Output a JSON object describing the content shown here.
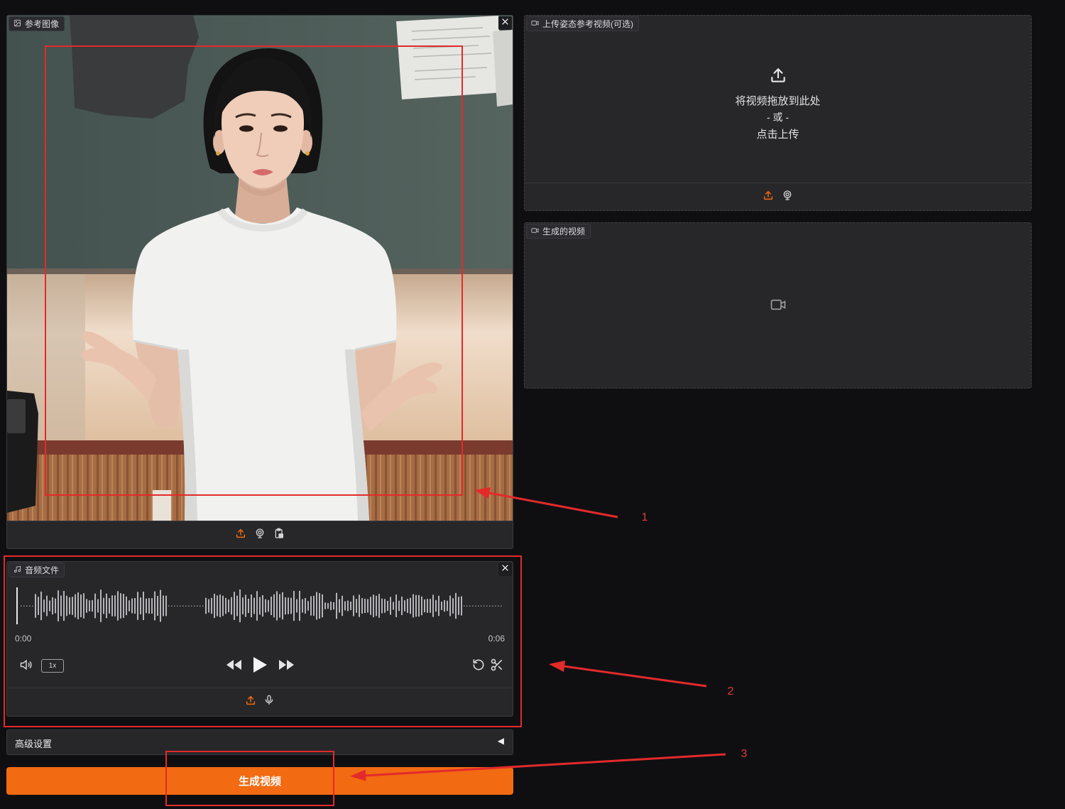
{
  "theme": {
    "background": "#0f0f12",
    "panel": "#27272a",
    "accent": "#f26a12",
    "annotation": "#e32a2a"
  },
  "reference_image": {
    "label": "参考图像",
    "icon": "image-icon",
    "toolbar_icons": [
      "upload-icon",
      "webcam-icon",
      "clipboard-icon"
    ]
  },
  "pose_video": {
    "label": "上传姿态参考视频(可选)",
    "icon": "video-icon",
    "drop_text": "将视频拖放到此处",
    "or_text": "- 或 -",
    "click_text": "点击上传",
    "toolbar_icons": [
      "upload-icon",
      "webcam-icon"
    ]
  },
  "output_video": {
    "label": "生成的视频",
    "icon": "video-icon",
    "placeholder_icon": "video-camera-icon"
  },
  "audio": {
    "label": "音频文件",
    "icon": "music-icon",
    "time_start": "0:00",
    "time_end": "0:06",
    "speed": "1x",
    "controls": [
      "volume-icon",
      "rewind-icon",
      "play-icon",
      "fast-forward-icon",
      "undo-icon",
      "scissors-icon"
    ],
    "toolbar_icons": [
      "upload-icon",
      "microphone-icon"
    ]
  },
  "advanced_settings": {
    "label": "高级设置",
    "arrow": "◀",
    "collapsed": true
  },
  "generate_button": {
    "label": "生成视频"
  },
  "annotations": {
    "labels": [
      "1",
      "2",
      "3"
    ]
  }
}
